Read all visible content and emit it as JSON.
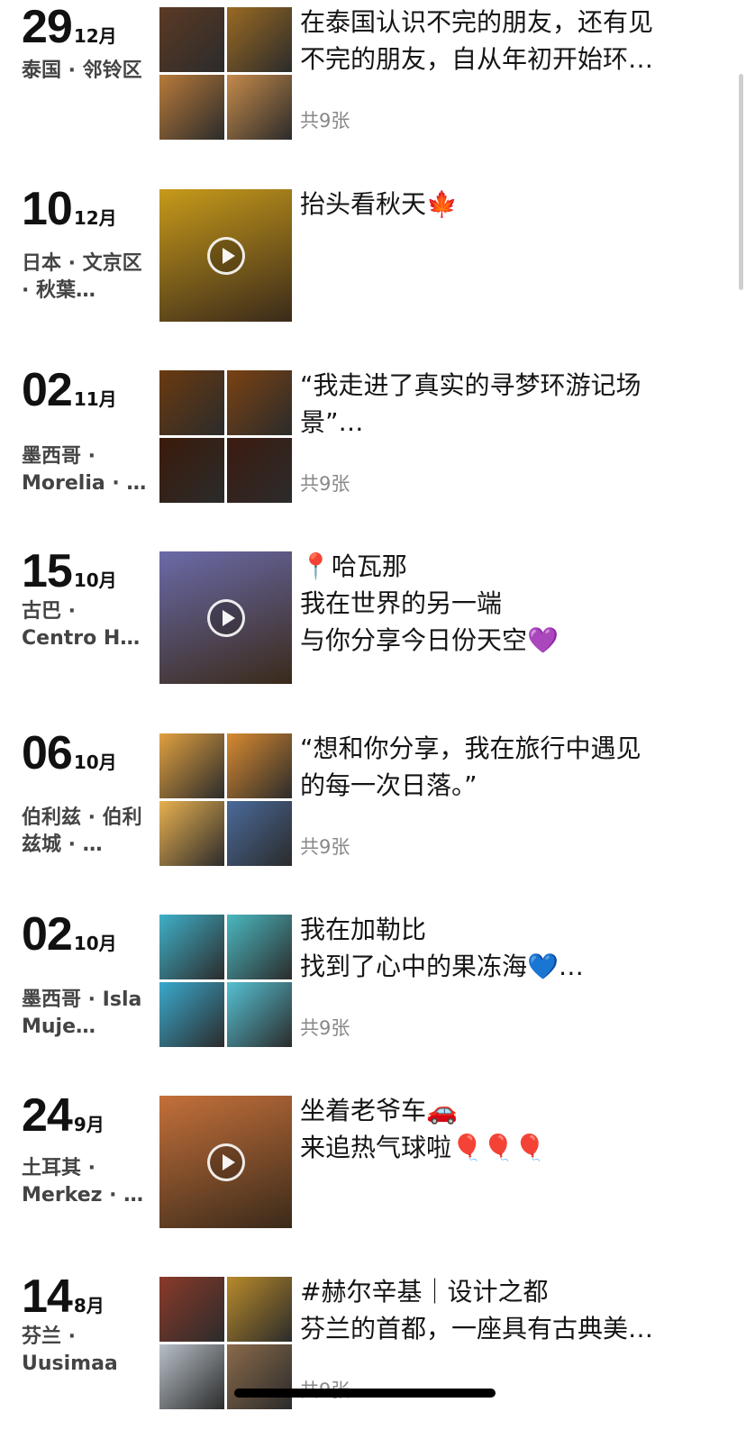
{
  "posts": [
    {
      "day": "29",
      "month": "12月",
      "location": "泰国 · 邻铃区",
      "lines": [
        "在泰国认识不完的朋友，还有见",
        "不完的朋友，自从年初开始环…"
      ],
      "count": "共9张",
      "media": "grid",
      "colors": [
        "#5b3a24",
        "#9a6a22",
        "#b87a3a",
        "#c58a4a"
      ]
    },
    {
      "day": "10",
      "month": "12月",
      "location": "日本 · 文京区 · 秋葉…",
      "lines": [
        "抬头看秋天🍁"
      ],
      "count": "",
      "media": "video",
      "colors": [
        "#c79a1a"
      ]
    },
    {
      "day": "02",
      "month": "11月",
      "location": "墨西哥 · Morelia · …",
      "lines": [
        "“我走进了真实的寻梦环游记场",
        "景”…"
      ],
      "count": "共9张",
      "media": "grid",
      "colors": [
        "#6a3a10",
        "#7a4212",
        "#3a1a0a",
        "#3c1b10"
      ]
    },
    {
      "day": "15",
      "month": "10月",
      "location": "古巴 · Centro H…",
      "lines": [
        "📍哈瓦那",
        "我在世界的另一端",
        "与你分享今日份天空💜"
      ],
      "count": "",
      "media": "video",
      "colors": [
        "#6a6aa8"
      ]
    },
    {
      "day": "06",
      "month": "10月",
      "location": "伯利兹 · 伯利兹城 · …",
      "lines": [
        "“想和你分享，我在旅行中遇见",
        "的每一次日落。”"
      ],
      "count": "共9张",
      "media": "grid",
      "colors": [
        "#e0a040",
        "#d88a30",
        "#e8b050",
        "#4a6a9a"
      ]
    },
    {
      "day": "02",
      "month": "10月",
      "location": "墨西哥 · Isla Muje…",
      "lines": [
        "我在加勒比",
        "找到了心中的果冻海💙…"
      ],
      "count": "共9张",
      "media": "grid",
      "colors": [
        "#3fb0c8",
        "#4ab8c0",
        "#3aa8cc",
        "#55c0d2"
      ]
    },
    {
      "day": "24",
      "month": "9月",
      "location": "土耳其 · Merkez · …",
      "lines": [
        "坐着老爷车🚗",
        "来追热气球啦🎈🎈🎈"
      ],
      "count": "",
      "media": "video",
      "colors": [
        "#c4703a"
      ]
    },
    {
      "day": "14",
      "month": "8月",
      "location": "芬兰 · Uusimaa",
      "lines": [
        "#赫尔辛基｜设计之都",
        "芬兰的首都，一座具有古典美…"
      ],
      "count": "共9张",
      "media": "grid",
      "colors": [
        "#8a3a2a",
        "#b88a2a",
        "#b8c0c8",
        "#8a6a4a"
      ]
    }
  ]
}
